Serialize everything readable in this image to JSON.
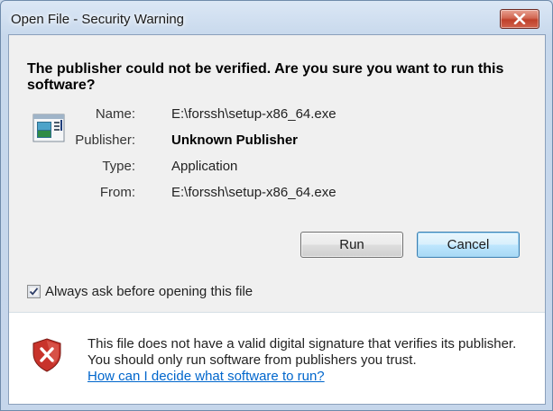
{
  "window": {
    "title": "Open File - Security Warning"
  },
  "headline": "The publisher could not be verified.  Are you sure you want to run this software?",
  "details": [
    {
      "label": "Name:",
      "value": "E:\\forssh\\setup-x86_64.exe",
      "bold": false
    },
    {
      "label": "Publisher:",
      "value": "Unknown Publisher",
      "bold": true
    },
    {
      "label": "Type:",
      "value": "Application",
      "bold": false
    },
    {
      "label": "From:",
      "value": "E:\\forssh\\setup-x86_64.exe",
      "bold": false
    }
  ],
  "buttons": {
    "run_label": "Run",
    "cancel_label": "Cancel"
  },
  "checkbox": {
    "label": "Always ask before opening this file",
    "checked": true
  },
  "warning": {
    "text": "This file does not have a valid digital signature that verifies its publisher.  You should only run software from publishers you trust.",
    "link_text": "How can I decide what software to run?"
  },
  "icons": {
    "app": "application-icon",
    "shield": "shield-error-icon",
    "close": "close-icon",
    "check": "check-icon"
  },
  "colors": {
    "link": "#0066cc",
    "close_button": "#c0402a",
    "default_button_border": "#3c7fb1"
  }
}
